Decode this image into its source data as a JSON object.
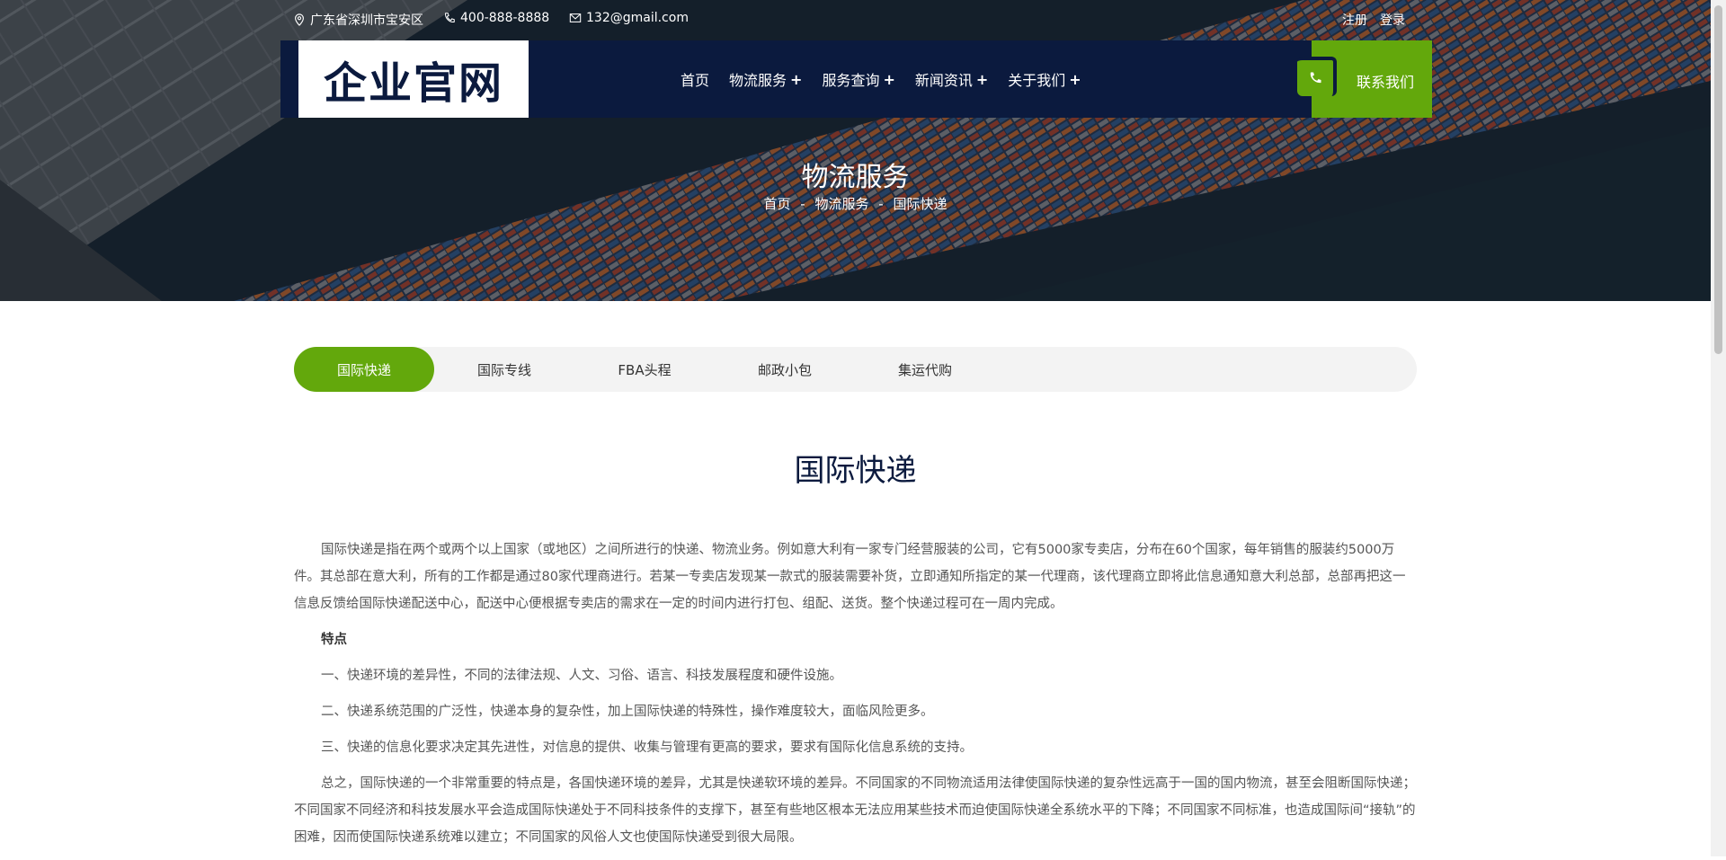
{
  "topbar": {
    "address": "广东省深圳市宝安区",
    "phone": "400-888-8888",
    "email": "132@gmail.com",
    "register": "注册",
    "login": "登录"
  },
  "header": {
    "logo": "企业官网",
    "menu": [
      {
        "label": "首页",
        "has_sub": false
      },
      {
        "label": "物流服务",
        "has_sub": true
      },
      {
        "label": "服务查询",
        "has_sub": true
      },
      {
        "label": "新闻资讯",
        "has_sub": true
      },
      {
        "label": "关于我们",
        "has_sub": true
      }
    ],
    "contact_label": "联系我们"
  },
  "banner": {
    "title": "物流服务",
    "breadcrumb": [
      "首页",
      "物流服务",
      "国际快递"
    ],
    "separator": "-"
  },
  "tabs": [
    {
      "label": "国际快递",
      "active": true
    },
    {
      "label": "国际专线",
      "active": false
    },
    {
      "label": "FBA头程",
      "active": false
    },
    {
      "label": "邮政小包",
      "active": false
    },
    {
      "label": "集运代购",
      "active": false
    }
  ],
  "article": {
    "title": "国际快递",
    "paragraphs": [
      {
        "text": "国际快递是指在两个或两个以上国家（或地区）之间所进行的快递、物流业务。例如意大利有一家专门经营服装的公司，它有5000家专卖店，分布在60个国家，每年销售的服装约5000万件。其总部在意大利，所有的工作都是通过80家代理商进行。若某一专卖店发现某一款式的服装需要补货，立即通知所指定的某一代理商，该代理商立即将此信息通知意大利总部，总部再把这一信息反馈给国际快递配送中心，配送中心便根据专卖店的需求在一定的时间内进行打包、组配、送货。整个快递过程可在一周内完成。",
        "bold": false
      },
      {
        "text": "特点",
        "bold": true
      },
      {
        "text": "一、快递环境的差异性，不同的法律法规、人文、习俗、语言、科技发展程度和硬件设施。",
        "bold": false
      },
      {
        "text": "二、快递系统范围的广泛性，快递本身的复杂性，加上国际快递的特殊性，操作难度较大，面临风险更多。",
        "bold": false
      },
      {
        "text": "三、快递的信息化要求决定其先进性，对信息的提供、收集与管理有更高的要求，要求有国际化信息系统的支持。",
        "bold": false
      },
      {
        "text": "总之，国际快递的一个非常重要的特点是，各国快递环境的差异，尤其是快递软环境的差异。不同国家的不同物流适用法律使国际快递的复杂性远高于一国的国内物流，甚至会阻断国际快递；不同国家不同经济和科技发展水平会造成国际快递处于不同科技条件的支撑下，甚至有些地区根本无法应用某些技术而迫使国际快递全系统水平的下降；不同国家不同标准，也造成国际间“接轨”的困难，因而使国际快递系统难以建立；不同国家的风俗人文也使国际快递受到很大局限。",
        "bold": false
      }
    ]
  },
  "colors": {
    "nav_bg": "#0b1a3e",
    "accent_green": "#63a80c",
    "tab_bg": "#f3f3f3"
  },
  "icons": {
    "address": "map-pin-icon",
    "phone": "phone-icon",
    "email": "envelope-icon",
    "contact": "phone-handset-icon"
  }
}
